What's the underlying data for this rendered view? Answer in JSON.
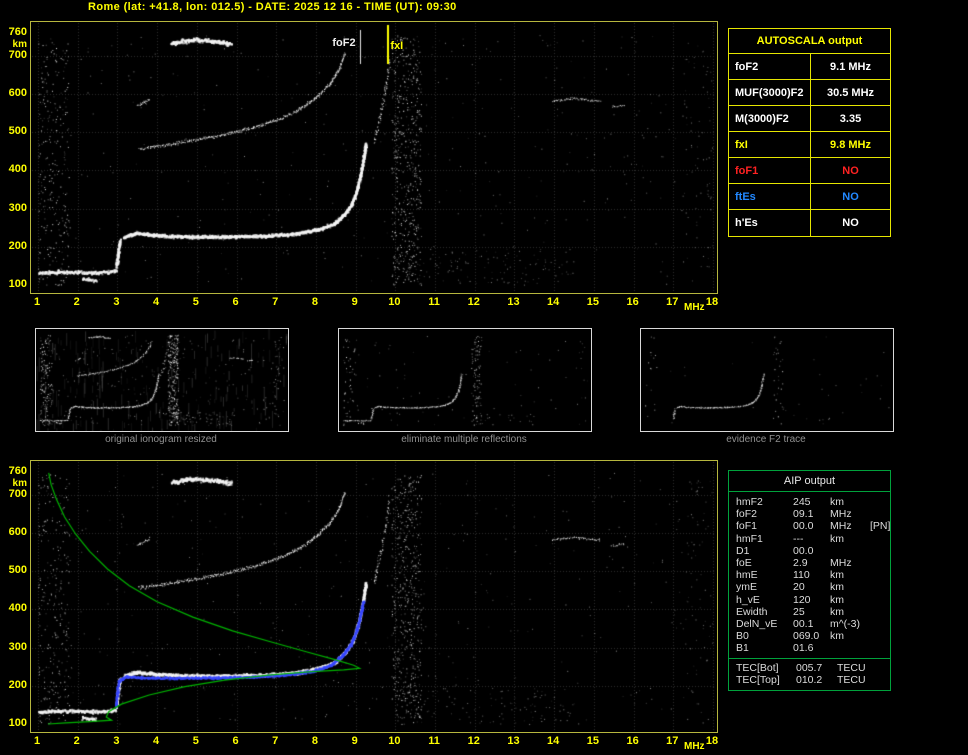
{
  "title": "Rome (lat: +41.8, lon: 012.5) - DATE: 2025 12 16 - TIME (UT): 09:30",
  "autoscala": {
    "header": "AUTOSCALA output",
    "rows": [
      {
        "param": "foF2",
        "value": "9.1 MHz",
        "color": "#ffffff"
      },
      {
        "param": "MUF(3000)F2",
        "value": "30.5 MHz",
        "color": "#ffffff"
      },
      {
        "param": "M(3000)F2",
        "value": "3.35",
        "color": "#ffffff"
      },
      {
        "param": "fxI",
        "value": "9.8 MHz",
        "color": "#ffff00"
      },
      {
        "param": "foF1",
        "value": "NO",
        "color": "#ff2222"
      },
      {
        "param": "ftEs",
        "value": "NO",
        "color": "#2288ff"
      },
      {
        "param": "h'Es",
        "value": "NO",
        "color": "#ffffff"
      }
    ]
  },
  "aip": {
    "header": "AIP output",
    "rows": [
      {
        "param": "hmF2",
        "value": "245",
        "unit": "km",
        "extra": ""
      },
      {
        "param": "foF2",
        "value": "09.1",
        "unit": "MHz",
        "extra": ""
      },
      {
        "param": "foF1",
        "value": "00.0",
        "unit": "MHz",
        "extra": "[PN]"
      },
      {
        "param": "hmF1",
        "value": "---",
        "unit": "km",
        "extra": ""
      },
      {
        "param": "D1",
        "value": "00.0",
        "unit": "",
        "extra": ""
      },
      {
        "param": "foE",
        "value": "2.9",
        "unit": "MHz",
        "extra": ""
      },
      {
        "param": "hmE",
        "value": "110",
        "unit": "km",
        "extra": ""
      },
      {
        "param": "ymE",
        "value": "20",
        "unit": "km",
        "extra": ""
      },
      {
        "param": "h_vE",
        "value": "120",
        "unit": "km",
        "extra": ""
      },
      {
        "param": "Ewidth",
        "value": "25",
        "unit": "km",
        "extra": ""
      },
      {
        "param": "DelN_vE",
        "value": "00.1",
        "unit": "m^(-3)",
        "extra": ""
      },
      {
        "param": "B0",
        "value": "069.0",
        "unit": "km",
        "extra": ""
      },
      {
        "param": "B1",
        "value": "01.6",
        "unit": "",
        "extra": ""
      }
    ],
    "tec_rows": [
      {
        "param": "TEC[Bot]",
        "value": "005.7",
        "unit": "TECU"
      },
      {
        "param": "TEC[Top]",
        "value": "010.2",
        "unit": "TECU"
      }
    ]
  },
  "axes": {
    "x_ticks": [
      "1",
      "2",
      "3",
      "4",
      "5",
      "6",
      "7",
      "8",
      "9",
      "10",
      "11",
      "12",
      "13",
      "14",
      "15",
      "16",
      "17",
      "18"
    ],
    "x_unit": "MHz",
    "y_ticks": [
      "760",
      "700",
      "600",
      "500",
      "400",
      "300",
      "200",
      "100"
    ],
    "y_unit": "km"
  },
  "thumbnails": [
    {
      "caption": "original ionogram resized"
    },
    {
      "caption": "eliminate multiple reflections"
    },
    {
      "caption": "evidence F2 trace"
    }
  ],
  "chart_data": {
    "type": "scatter",
    "description": "vertical incidence ionogram: virtual height (km) vs sounding frequency (MHz); top plot = scaled ionogram, bottom plot = ionogram with AIP electron density profile (green) and fitted trace (blue)",
    "x_axis": {
      "label": "MHz",
      "min": 1,
      "max": 18
    },
    "y_axis": {
      "label": "km",
      "min": 100,
      "max": 760
    },
    "markers": {
      "foF2_label": "foF2",
      "fxI_label": "fxI",
      "foF2_mhz": 9.1,
      "fxI_mhz": 9.8
    },
    "traces": [
      {
        "id": "E",
        "points": [
          [
            1.0,
            133
          ],
          [
            1.5,
            136
          ],
          [
            2.0,
            135
          ],
          [
            2.5,
            134
          ],
          [
            2.95,
            138
          ]
        ],
        "spread": 6,
        "density": 2.2,
        "size": 2
      },
      {
        "id": "E-blob",
        "points": [
          [
            2.1,
            118
          ],
          [
            2.45,
            114
          ]
        ],
        "spread": 6,
        "density": 1.8,
        "size": 2
      },
      {
        "id": "F-cusp",
        "points": [
          [
            2.96,
            150
          ],
          [
            3.0,
            185
          ],
          [
            3.05,
            218
          ]
        ],
        "spread": 9,
        "density": 3.0,
        "size": 2
      },
      {
        "id": "F",
        "points": [
          [
            3.15,
            226
          ],
          [
            3.45,
            238
          ],
          [
            3.9,
            232
          ],
          [
            4.7,
            228
          ],
          [
            5.7,
            228
          ],
          [
            6.7,
            230
          ],
          [
            7.5,
            236
          ],
          [
            8.05,
            247
          ],
          [
            8.45,
            262
          ],
          [
            8.7,
            286
          ],
          [
            8.9,
            316
          ],
          [
            9.02,
            350
          ],
          [
            9.12,
            394
          ],
          [
            9.2,
            440
          ],
          [
            9.24,
            472
          ]
        ],
        "spread": 6,
        "density": 2.8,
        "size": 2
      },
      {
        "id": "F2-multiple",
        "points": [
          [
            3.55,
            458
          ],
          [
            4.1,
            466
          ],
          [
            4.8,
            478
          ],
          [
            5.6,
            493
          ],
          [
            6.4,
            513
          ],
          [
            7.1,
            537
          ],
          [
            7.6,
            562
          ],
          [
            8.0,
            592
          ],
          [
            8.35,
            628
          ],
          [
            8.6,
            670
          ],
          [
            8.72,
            708
          ]
        ],
        "spread": 6,
        "density": 1.5,
        "size": 1
      },
      {
        "id": "E-multiple",
        "points": [
          [
            4.35,
            735
          ],
          [
            4.9,
            744
          ],
          [
            5.4,
            740
          ],
          [
            5.85,
            732
          ]
        ],
        "spread": 8,
        "density": 2.6,
        "size": 2
      },
      {
        "id": "F3-fragment",
        "points": [
          [
            3.5,
            570
          ],
          [
            3.8,
            586
          ]
        ],
        "spread": 5,
        "density": 1.2,
        "size": 1
      },
      {
        "id": "xmode-top",
        "points": [
          [
            9.45,
            470
          ],
          [
            9.6,
            540
          ],
          [
            9.75,
            620
          ],
          [
            9.85,
            690
          ]
        ],
        "spread": 22,
        "density": 0.7,
        "size": 1
      },
      {
        "id": "spread-high",
        "points": [
          [
            13.95,
            583
          ],
          [
            14.5,
            590
          ],
          [
            15.15,
            582
          ]
        ],
        "spread": 4,
        "density": 1.0,
        "size": 1
      },
      {
        "id": "spread-high-2",
        "points": [
          [
            15.45,
            568
          ],
          [
            15.75,
            572
          ]
        ],
        "spread": 4,
        "density": 1.0,
        "size": 1
      }
    ],
    "noise_bands": [
      {
        "id": "background",
        "f": [
          1.0,
          17.9
        ],
        "km": [
          100,
          758
        ],
        "count": 380,
        "dim": true
      },
      {
        "id": "left-band",
        "f": [
          1.0,
          1.8
        ],
        "km": [
          100,
          755
        ],
        "count": 260,
        "dim": false
      },
      {
        "id": "band-10mhz",
        "f": [
          9.9,
          10.65
        ],
        "km": [
          100,
          755
        ],
        "count": 520,
        "dim": false
      },
      {
        "id": "low-right",
        "f": [
          10.2,
          14.5
        ],
        "km": [
          100,
          195
        ],
        "count": 110,
        "dim": true
      },
      {
        "id": "right-edge",
        "f": [
          17.2,
          18.0
        ],
        "km": [
          100,
          740
        ],
        "count": 70,
        "dim": true
      }
    ],
    "profile_color": "#00b400",
    "profile": [
      [
        1.25,
        100
      ],
      [
        1.7,
        103
      ],
      [
        2.3,
        106
      ],
      [
        2.85,
        110
      ],
      [
        2.72,
        118
      ],
      [
        2.78,
        132
      ],
      [
        3.1,
        152
      ],
      [
        3.8,
        176
      ],
      [
        4.7,
        198
      ],
      [
        5.7,
        215
      ],
      [
        6.8,
        228
      ],
      [
        7.9,
        237
      ],
      [
        8.7,
        242
      ],
      [
        9.1,
        246
      ],
      [
        8.95,
        254
      ],
      [
        8.5,
        268
      ],
      [
        7.8,
        288
      ],
      [
        6.9,
        314
      ],
      [
        5.9,
        344
      ],
      [
        4.9,
        380
      ],
      [
        4.0,
        420
      ],
      [
        3.3,
        462
      ],
      [
        2.75,
        506
      ],
      [
        2.3,
        552
      ],
      [
        1.95,
        597
      ],
      [
        1.67,
        642
      ],
      [
        1.47,
        687
      ],
      [
        1.33,
        727
      ],
      [
        1.27,
        758
      ]
    ],
    "fitted_color": "#3746ff",
    "fitted": [
      [
        2.95,
        148
      ],
      [
        2.98,
        182
      ],
      [
        3.02,
        214
      ],
      [
        3.2,
        226
      ],
      [
        3.6,
        223
      ],
      [
        4.4,
        222
      ],
      [
        5.4,
        223
      ],
      [
        6.4,
        225
      ],
      [
        7.2,
        230
      ],
      [
        7.9,
        240
      ],
      [
        8.35,
        255
      ],
      [
        8.65,
        280
      ],
      [
        8.88,
        312
      ],
      [
        9.02,
        350
      ],
      [
        9.12,
        392
      ],
      [
        9.18,
        424
      ]
    ]
  },
  "colors": {
    "accent_yellow": "#ffff00",
    "plot_border": "#b6b63e",
    "autoscala_border": "#e6e600",
    "aip_border": "#00a23c",
    "foF1_red": "#ff2222",
    "ftEs_blue": "#2288ff",
    "grid": "#2e2e2e",
    "caption_gray": "#909090"
  }
}
